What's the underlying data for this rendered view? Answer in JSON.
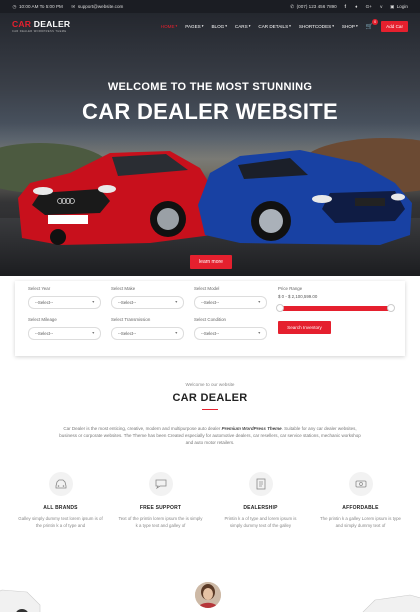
{
  "topbar": {
    "hours": "10:00 AM To 5:00 PM",
    "email": "support@website.com",
    "phone": "(007) 123 456 7890",
    "social_icons": [
      "phone-icon",
      "facebook-icon",
      "twitter-icon",
      "googleplus-icon",
      "vimeo-icon"
    ],
    "login": "Login"
  },
  "nav": {
    "logo_car": "CAR",
    "logo_dealer": " DEALER",
    "logo_tagline": "CAR DEALER WORDPRESS THEME",
    "items": [
      {
        "label": "HOME"
      },
      {
        "label": "PAGES"
      },
      {
        "label": "BLOG"
      },
      {
        "label": "CARS"
      },
      {
        "label": "CAR DETAILS"
      },
      {
        "label": "SHORTCODES"
      },
      {
        "label": "SHOP"
      }
    ],
    "cart_count": "0",
    "add_car": "Add Car"
  },
  "hero": {
    "subtitle": "WELCOME TO THE MOST STUNNING",
    "title": "CAR DEALER WEBSITE",
    "learn_more": "learn more"
  },
  "search": {
    "year_label": "Select Year",
    "make_label": "Select Make",
    "model_label": "Select Model",
    "mileage_label": "Select Mileage",
    "transmission_label": "Select Transmission",
    "condition_label": "Select Condition",
    "select_placeholder": "--Select--",
    "price_label": "Price Range",
    "price_value": "$ 0 - $ 2,100,599.00",
    "price_range": {
      "min_fraction": 0.0,
      "max_fraction": 1.0
    },
    "button": "Search Inventory"
  },
  "intro": {
    "welcome": "Welcome to our website",
    "title": "CAR DEALER",
    "text_a": "Car Dealer is the most enticing, creative, modern and multipurpose auto dealer ",
    "text_b": "Premium WordPress Theme",
    "text_c": ". Suitable for any car dealer websites, business or corporate websites. The Theme has been Created especially for automotive dealers, car resellers, car service stations, mechanic workshop and auto motor retailers."
  },
  "features": [
    {
      "icon": "car-icon",
      "title": "ALL BRANDS",
      "text": "Galley simply dummy text lorem ipsum is of the printin k a of type and"
    },
    {
      "icon": "chat-icon",
      "title": "FREE SUPPORT",
      "text": "Text of the printin lorem ipsum the is simply k a type text and galley of"
    },
    {
      "icon": "document-icon",
      "title": "DEALERSHIP",
      "text": "Printin k a of type and lorem ipsum is simply dummy text of the galley"
    },
    {
      "icon": "dollar-icon",
      "title": "AFFORDABLE",
      "text": "The printin k a galley Lorem ipsum is type and simply dummy text of"
    }
  ],
  "colors": {
    "accent": "#e5202e",
    "topbar": "#1b1d23"
  }
}
